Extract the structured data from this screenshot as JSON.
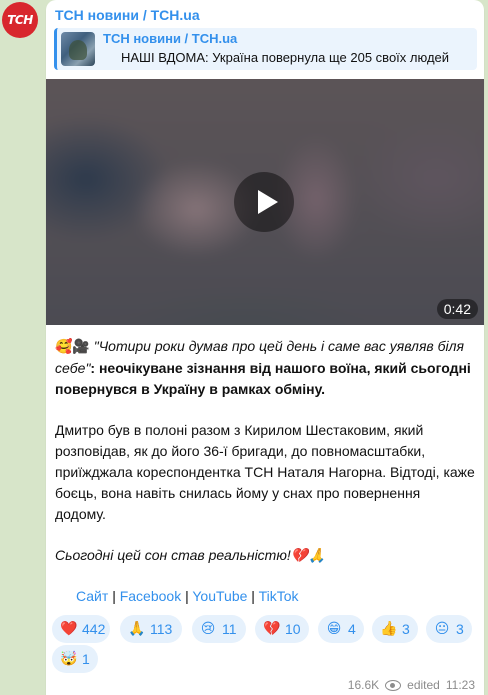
{
  "avatar": {
    "text": "ТСН"
  },
  "channel_name": "ТСН новини / TCH.ua",
  "reply": {
    "title": "ТСН новини / TCH.ua",
    "text": "НАШІ ВДОМА: Україна повернула ще 205 своїх людей"
  },
  "video": {
    "duration": "0:42"
  },
  "post": {
    "emoji_prefix": "🥰🎥",
    "quote": "\"Чотири роки думав про цей день і саме вас уявляв біля себе\"",
    "bold": ": неочікуване зізнання від нашого воїна, який сьогодні повернувся в Україну в рамках обміну.",
    "p2": "Дмитро був в полоні разом з Кирилом Шестаковим, який розповідав, як до його 36-ї бригади, до повномасштабки, приїжджала кореспондентка ТСН Наталя Нагорна. Відтоді, каже боєць, вона навіть снилась йому у снах про повернення додому.",
    "p3": "Сьогодні цей сон став реальністю!",
    "p3_emoji": "💔🙏"
  },
  "links": {
    "site": "Сайт",
    "facebook": "Facebook",
    "youtube": "YouTube",
    "tiktok": "TikTok",
    "separator": "|"
  },
  "reactions": [
    {
      "emoji": "❤️",
      "icon": "heart-icon",
      "count": "442"
    },
    {
      "emoji": "🙏",
      "icon": "pray-icon",
      "count": "113"
    },
    {
      "emoji": "😢",
      "icon": "crying-face-icon",
      "count": "11"
    },
    {
      "emoji": "💔",
      "icon": "broken-heart-icon",
      "count": "10"
    },
    {
      "emoji": "😁",
      "icon": "grinning-face-icon",
      "count": "4"
    },
    {
      "emoji": "👍",
      "icon": "thumbs-up-icon",
      "count": "3"
    },
    {
      "emoji": "😐",
      "icon": "neutral-face-icon",
      "count": "3"
    },
    {
      "emoji": "🤯",
      "icon": "exploding-head-icon",
      "count": "1"
    }
  ],
  "footer": {
    "views": "16.6K",
    "edited": "edited",
    "time": "11:23"
  },
  "colors": {
    "accent": "#3390ec",
    "background": "#d7e5c9",
    "avatar": "#d8272d"
  }
}
